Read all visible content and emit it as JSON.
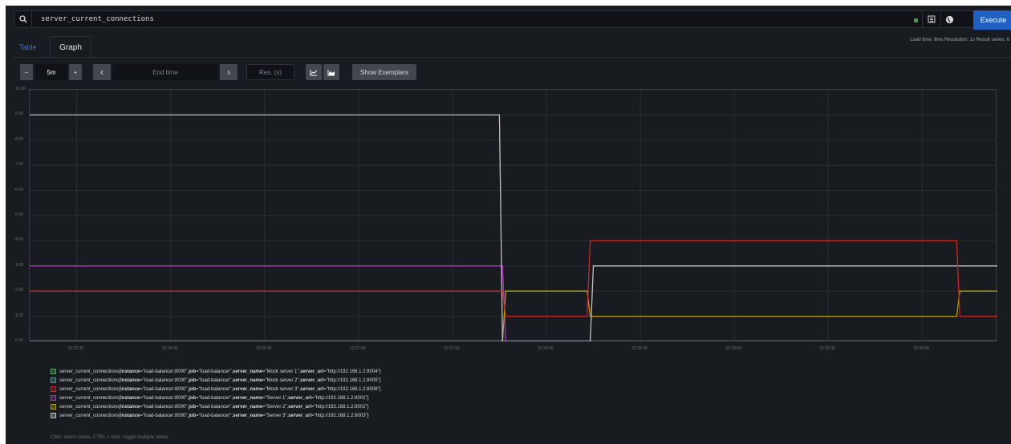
{
  "query": {
    "text": "server_current_connections",
    "execute_label": "Execute"
  },
  "tabs": {
    "table": "Table",
    "graph": "Graph"
  },
  "stats": "Load time: 9ms   Resolution: 1s   Result series: 6",
  "controls": {
    "range": "5m",
    "minus": "−",
    "plus": "+",
    "prev": "‹",
    "next": "›",
    "end_time_placeholder": "End time",
    "resolution_placeholder": "Res. (s)",
    "show_exemplars": "Show Exemplars"
  },
  "graph": {
    "y_ticks": [
      "10.00",
      "9.00",
      "8.00",
      "7.00",
      "6.00",
      "5.00",
      "4.00",
      "3.00",
      "2.00",
      "1.00",
      "0.00"
    ],
    "x_ticks": [
      "22:25:30",
      "22:26:00",
      "22:26:30",
      "22:27:00",
      "22:27:30",
      "22:28:00",
      "22:28:30",
      "22:29:00",
      "22:29:30",
      "22:30:00"
    ]
  },
  "legend": {
    "metric": "server_current_connections",
    "items": [
      {
        "color": "#4caf50",
        "instance": "\"load-balancer:8000\"",
        "job": "\"load-balancer\"",
        "server_name": "\"Mock server 1\"",
        "server_url": "\"http://192.168.1.2:8004\""
      },
      {
        "color": "#26a69a",
        "instance": "\"load-balancer:8000\"",
        "job": "\"load-balancer\"",
        "server_name": "\"Mock server 2\"",
        "server_url": "\"http://192.168.1.2:8005\""
      },
      {
        "color": "#c62828",
        "instance": "\"load-balancer:8000\"",
        "job": "\"load-balancer\"",
        "server_name": "\"Mock server 3\"",
        "server_url": "\"http://192.168.1.2:8006\""
      },
      {
        "color": "#c026d3",
        "instance": "\"load-balancer:8000\"",
        "job": "\"load-balancer\"",
        "server_name": "\"Server 1\"",
        "server_url": "\"http://192.168.1.2:8001\""
      },
      {
        "color": "#b8a000",
        "instance": "\"load-balancer:8000\"",
        "job": "\"load-balancer\"",
        "server_name": "\"Server 2\"",
        "server_url": "\"http://192.168.1.2:8002\""
      },
      {
        "color": "#c0c0c0",
        "instance": "\"load-balancer:8000\"",
        "job": "\"load-balancer\"",
        "server_name": "\"Server 3\"",
        "server_url": "\"http://192.168.1.2:8003\""
      }
    ],
    "hint": "Click: select series, CTRL + click: toggle multiple series"
  },
  "chart_data": {
    "type": "line",
    "ylim": [
      0,
      10
    ],
    "grid": true,
    "x_unit": "time",
    "series": [
      {
        "name": "Server 1",
        "color": "#c026d3",
        "points": [
          [
            "22:25:15",
            3
          ],
          [
            "22:27:46",
            3
          ],
          [
            "22:27:47",
            0
          ],
          [
            "22:30:24",
            0
          ]
        ]
      },
      {
        "name": "Server 2",
        "color": "#b8a000",
        "points": [
          [
            "22:25:15",
            0
          ],
          [
            "22:27:46",
            0
          ],
          [
            "22:27:47",
            2
          ],
          [
            "22:28:13",
            2
          ],
          [
            "22:28:14",
            1
          ],
          [
            "22:30:11",
            1
          ],
          [
            "22:30:12",
            2
          ],
          [
            "22:30:24",
            2
          ]
        ]
      },
      {
        "name": "Server 3",
        "color": "#c0c0c0",
        "points": [
          [
            "22:25:15",
            9
          ],
          [
            "22:27:45",
            9
          ],
          [
            "22:27:46",
            0
          ],
          [
            "22:28:14",
            0
          ],
          [
            "22:28:15",
            3
          ],
          [
            "22:30:24",
            3
          ]
        ]
      },
      {
        "name": "Mock server 3",
        "color": "#c62828",
        "points": [
          [
            "22:25:15",
            2
          ],
          [
            "22:27:46",
            2
          ],
          [
            "22:27:47",
            1
          ],
          [
            "22:28:13",
            1
          ],
          [
            "22:28:14",
            4
          ],
          [
            "22:30:11",
            4
          ],
          [
            "22:30:12",
            1
          ],
          [
            "22:30:24",
            1
          ]
        ]
      }
    ]
  }
}
